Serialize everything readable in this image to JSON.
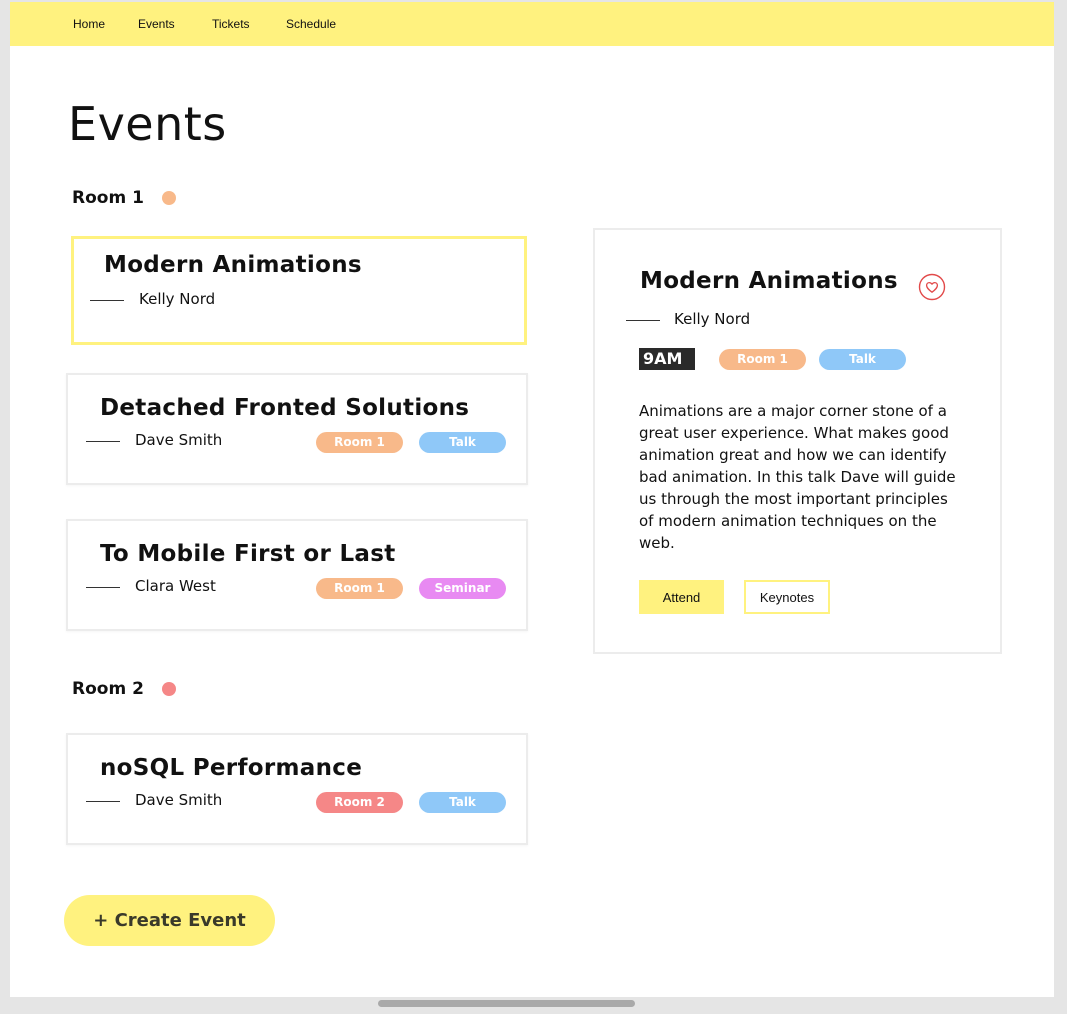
{
  "nav": {
    "items": [
      "Home",
      "Events",
      "Tickets",
      "Schedule"
    ]
  },
  "page": {
    "title": "Events"
  },
  "colors": {
    "accent": "#fff27f",
    "room1": "#f8b98a",
    "room2": "#f58787",
    "talk": "#8fc8f8",
    "seminar": "#e88af2"
  },
  "rooms": [
    {
      "label": "Room 1"
    },
    {
      "label": "Room 2"
    }
  ],
  "events": [
    {
      "title": "Modern Animations",
      "speaker": "Kelly Nord"
    },
    {
      "title": "Detached Fronted Solutions",
      "speaker": "Dave Smith",
      "room": "Room 1",
      "type": "Talk"
    },
    {
      "title": "To Mobile First or Last",
      "speaker": "Clara West",
      "room": "Room 1",
      "type": "Seminar"
    },
    {
      "title": "noSQL Performance",
      "speaker": "Dave Smith",
      "room": "Room 2",
      "type": "Talk"
    }
  ],
  "detail": {
    "title": "Modern Animations",
    "speaker": "Kelly Nord",
    "time": "9AM",
    "room": "Room 1",
    "type": "Talk",
    "description": "Animations are a major corner stone of a great user experience. What makes good animation great and how we can identify bad animation. In this talk Dave will guide us through the most important principles of modern animation techniques on the web.",
    "attend_label": "Attend",
    "keynotes_label": "Keynotes",
    "favorite_icon": "heart-icon"
  },
  "actions": {
    "create_event_label": "+ Create Event"
  }
}
